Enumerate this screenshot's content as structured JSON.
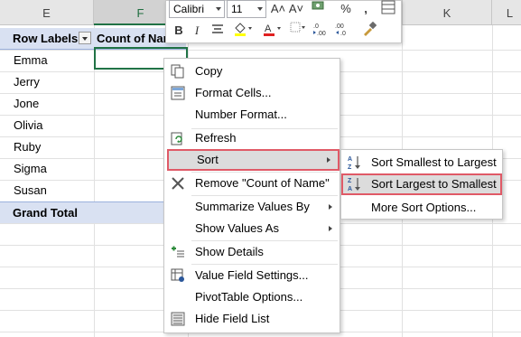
{
  "columns": [
    "E",
    "F",
    "K",
    "L"
  ],
  "pivot": {
    "row_labels_header": "Row Labels",
    "value_header": "Count of Name",
    "rows": [
      "Emma",
      "Jerry",
      "Jone",
      "Olivia",
      "Ruby",
      "Sigma",
      "Susan"
    ],
    "grand_total": "Grand Total"
  },
  "mini_toolbar": {
    "font_name": "Calibri",
    "font_size": "11",
    "increase_font": "A˄",
    "decrease_font": "A˅",
    "percent": "%",
    "comma": ",",
    "bold": "B",
    "italic": "I"
  },
  "context_menu": [
    {
      "label": "Copy",
      "icon": "copy-icon"
    },
    {
      "label": "Format Cells...",
      "icon": "format-cells-icon"
    },
    {
      "label": "Number Format...",
      "icon": ""
    },
    {
      "label": "Refresh",
      "icon": "refresh-icon"
    },
    {
      "label": "Sort",
      "icon": ""
    },
    {
      "label": "Remove \"Count of Name\"",
      "icon": "remove-x-icon"
    },
    {
      "label": "Summarize Values By",
      "icon": ""
    },
    {
      "label": "Show Values As",
      "icon": ""
    },
    {
      "label": "Show Details",
      "icon": "show-details-icon"
    },
    {
      "label": "Value Field Settings...",
      "icon": "value-field-settings-icon"
    },
    {
      "label": "PivotTable Options...",
      "icon": ""
    },
    {
      "label": "Hide Field List",
      "icon": "field-list-icon"
    }
  ],
  "sort_submenu": [
    {
      "label": "Sort Smallest to Largest",
      "icon": "sort-ascending-icon"
    },
    {
      "label": "Sort Largest to Smallest",
      "icon": "sort-descending-icon"
    },
    {
      "label": "More Sort Options...",
      "icon": ""
    }
  ],
  "colors": {
    "pivot_header_fill": "#d9e1f2",
    "highlight_border": "#e05a67",
    "excel_green": "#217346"
  }
}
